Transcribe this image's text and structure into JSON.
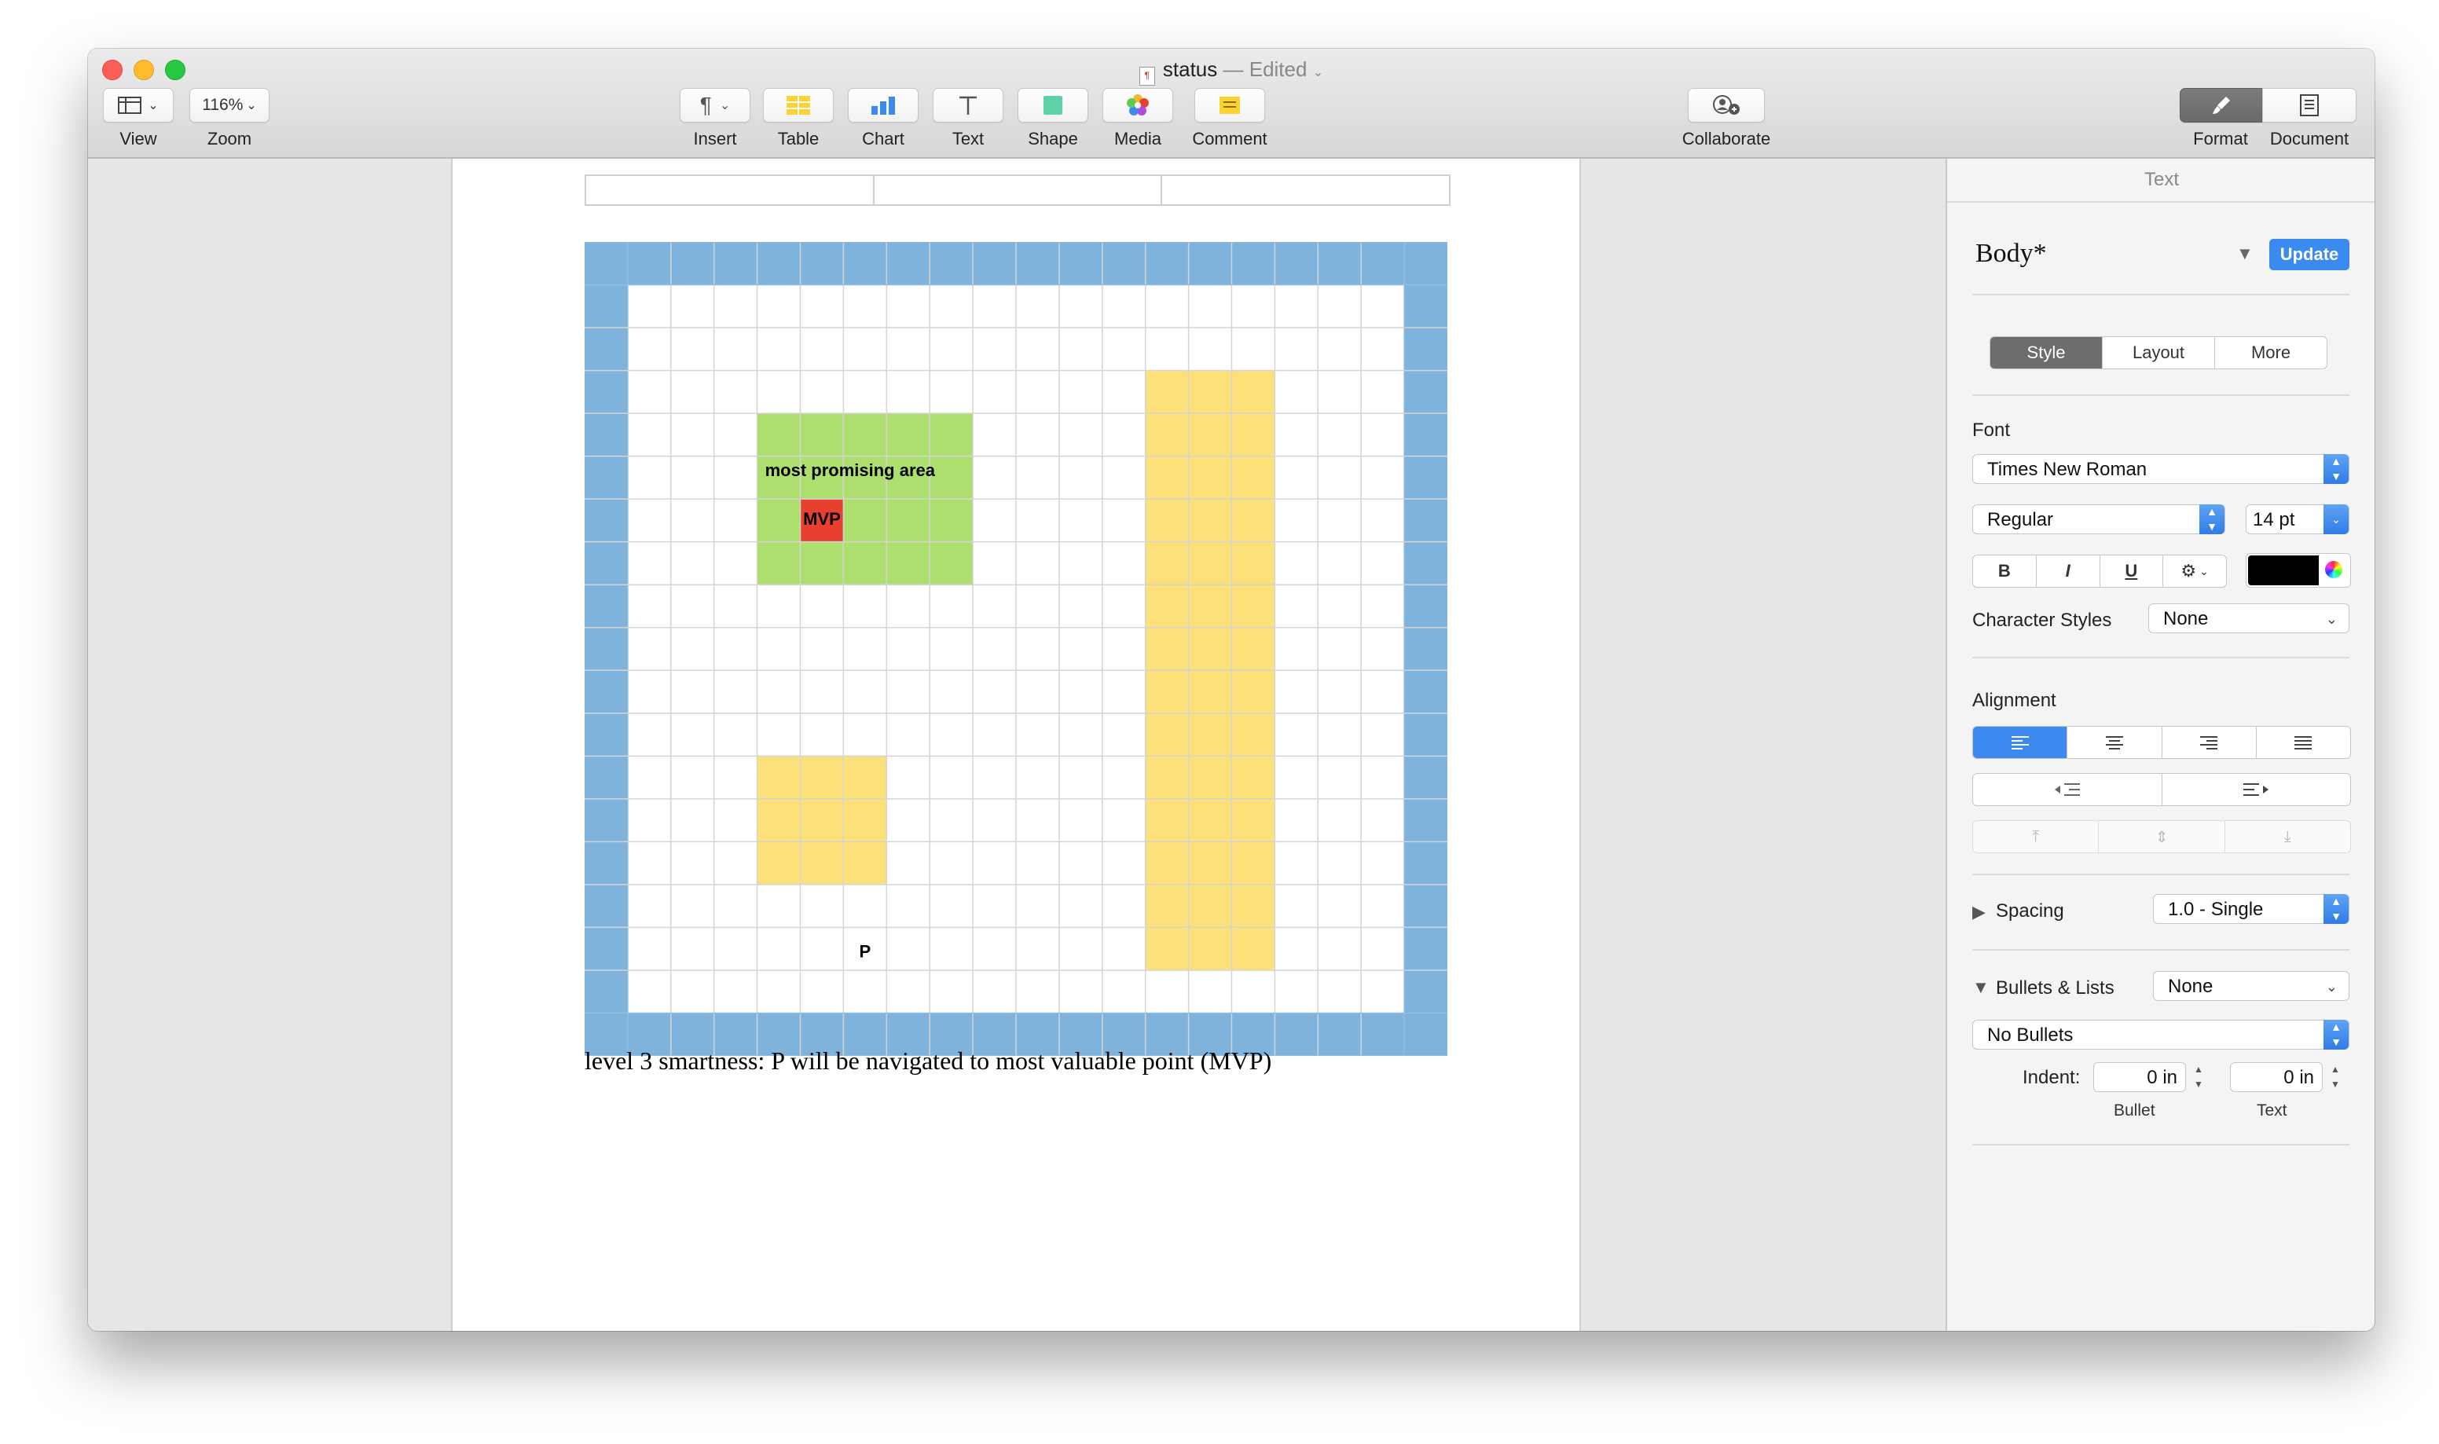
{
  "window": {
    "title": "status",
    "title_status": "— Edited"
  },
  "toolbar": {
    "view_label": "View",
    "zoom_value": "116%",
    "zoom_label": "Zoom",
    "insert_label": "Insert",
    "table_label": "Table",
    "chart_label": "Chart",
    "text_label": "Text",
    "shape_label": "Shape",
    "media_label": "Media",
    "comment_label": "Comment",
    "collaborate_label": "Collaborate",
    "format_label": "Format",
    "document_label": "Document"
  },
  "document": {
    "grid": {
      "cols": 20,
      "rows": 19,
      "colors": {
        "border": "#7fb3db",
        "line": "#d4d4d4",
        "cell": "#ffffff",
        "green": "#addf6f",
        "yellow": "#fce07a",
        "red": "#e8402f"
      },
      "green_area_label": "most promising area",
      "mvp_label": "MVP",
      "p_label": "P"
    },
    "caption": "level 3 smartness: P will be navigated to most valuable point (MVP)"
  },
  "inspector": {
    "header": "Text",
    "style_name": "Body*",
    "update_button": "Update",
    "tabs": [
      "Style",
      "Layout",
      "More"
    ],
    "font_section": "Font",
    "font_family": "Times New Roman",
    "font_weight": "Regular",
    "font_size": "14 pt",
    "bold": "B",
    "italic": "I",
    "underline": "U",
    "text_color": "#000000",
    "character_styles_label": "Character Styles",
    "character_styles_value": "None",
    "alignment_label": "Alignment",
    "spacing_label": "Spacing",
    "spacing_value": "1.0 - Single",
    "bullets_label": "Bullets & Lists",
    "bullets_value": "None",
    "bullets_style": "No Bullets",
    "indent_label": "Indent:",
    "indent_bullet_value": "0 in",
    "indent_text_value": "0 in",
    "indent_bullet_caption": "Bullet",
    "indent_text_caption": "Text"
  }
}
